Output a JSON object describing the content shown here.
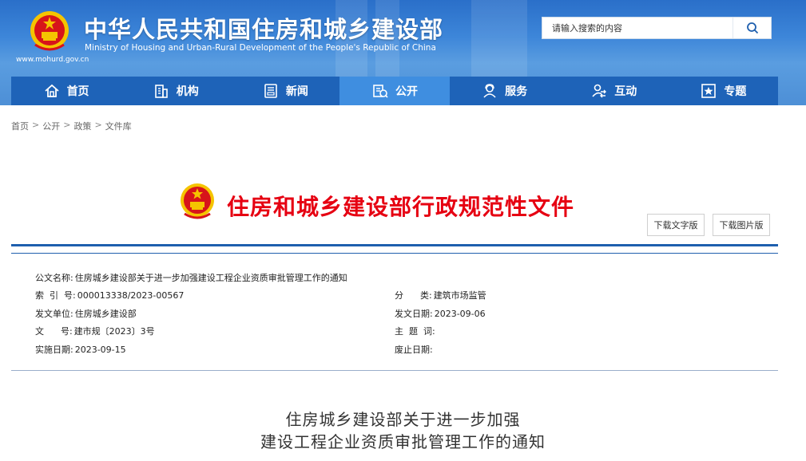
{
  "header": {
    "title": "中华人民共和国住房和城乡建设部",
    "subtitle": "Ministry of Housing and Urban-Rural Development of the People's Republic of China",
    "url": "www.mohurd.gov.cn",
    "emblem_icon": "national-emblem-icon",
    "search": {
      "placeholder": "请输入搜索的内容",
      "icon": "search-icon"
    }
  },
  "nav": {
    "items": [
      {
        "label": "首页",
        "icon": "home-icon"
      },
      {
        "label": "机构",
        "icon": "building-icon"
      },
      {
        "label": "新闻",
        "icon": "news-icon"
      },
      {
        "label": "公开",
        "icon": "document-icon",
        "active": true
      },
      {
        "label": "服务",
        "icon": "service-icon"
      },
      {
        "label": "互动",
        "icon": "interaction-icon"
      },
      {
        "label": "专题",
        "icon": "star-icon"
      }
    ]
  },
  "breadcrumb": [
    "首页",
    "公开",
    "政策",
    "文件库"
  ],
  "banner": {
    "title": "住房和城乡建设部行政规范性文件",
    "download_text": "下载文字版",
    "download_image": "下载图片版"
  },
  "info": {
    "doc_name_label": "公文名称:",
    "doc_name": "住房城乡建设部关于进一步加强建设工程企业资质审批管理工作的通知",
    "index_label": "索  引  号:",
    "index": "000013338/2023-00567",
    "category_label": "分      类:",
    "category": "建筑市场监管",
    "issuer_label": "发文单位:",
    "issuer": "住房城乡建设部",
    "date_label": "发文日期:",
    "date": "2023-09-06",
    "doc_no_label": "文      号:",
    "doc_no": "建市规〔2023〕3号",
    "subject_label": "主  题  词:",
    "subject": "",
    "effective_label": "实施日期:",
    "effective": "2023-09-15",
    "expire_label": "废止日期:",
    "expire": ""
  },
  "document": {
    "title_line1": "住房城乡建设部关于进一步加强",
    "title_line2": "建设工程企业资质审批管理工作的通知"
  },
  "colors": {
    "nav": "#1e63b8",
    "nav_active": "#3f8ee0",
    "banner_red": "#e60012",
    "rule": "#1e5fae"
  }
}
